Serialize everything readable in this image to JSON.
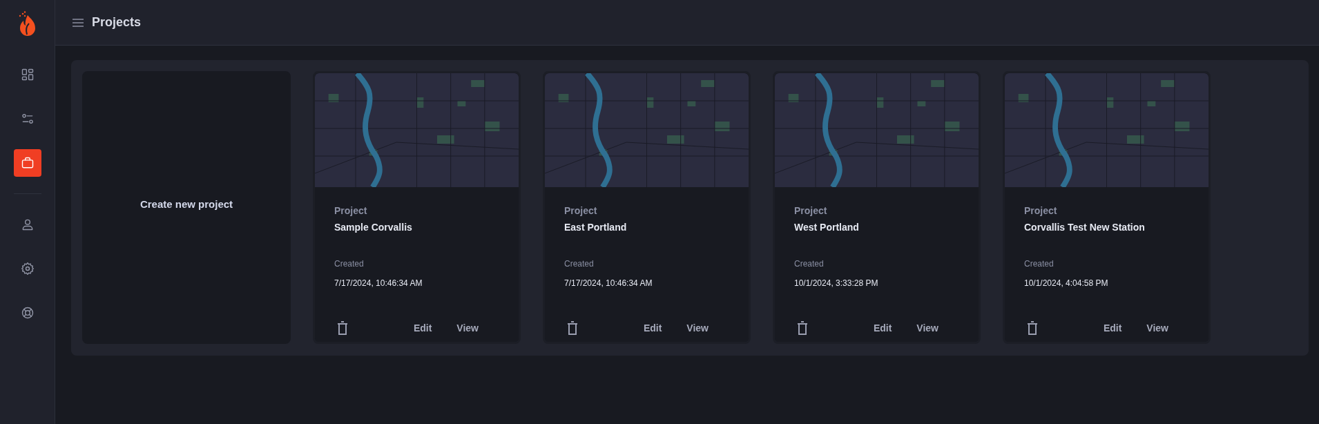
{
  "header": {
    "title": "Projects"
  },
  "sidebar": {
    "primary_items": [
      {
        "kind": "dashboard",
        "selected": false
      },
      {
        "kind": "filters",
        "selected": false
      },
      {
        "kind": "briefcase",
        "selected": true
      }
    ],
    "secondary_items": [
      {
        "kind": "user",
        "selected": false
      },
      {
        "kind": "settings",
        "selected": false
      },
      {
        "kind": "support",
        "selected": false
      }
    ]
  },
  "create_card": {
    "label": "Create new project"
  },
  "projects": [
    {
      "label": "Project",
      "name": "Sample Corvallis",
      "created_label": "Created",
      "created": "7/17/2024, 10:46:34 AM",
      "actions": [
        "Edit",
        "View"
      ]
    },
    {
      "label": "Project",
      "name": "East Portland",
      "created_label": "Created",
      "created": "7/17/2024, 10:46:34 AM",
      "actions": [
        "Edit",
        "View"
      ]
    },
    {
      "label": "Project",
      "name": "West Portland",
      "created_label": "Created",
      "created": "10/1/2024, 3:33:28 PM",
      "actions": [
        "Edit",
        "View"
      ]
    },
    {
      "label": "Project",
      "name": "Corvallis Test New Station",
      "created_label": "Created",
      "created": "10/1/2024, 4:04:58 PM",
      "actions": [
        "Edit",
        "View"
      ]
    }
  ]
}
